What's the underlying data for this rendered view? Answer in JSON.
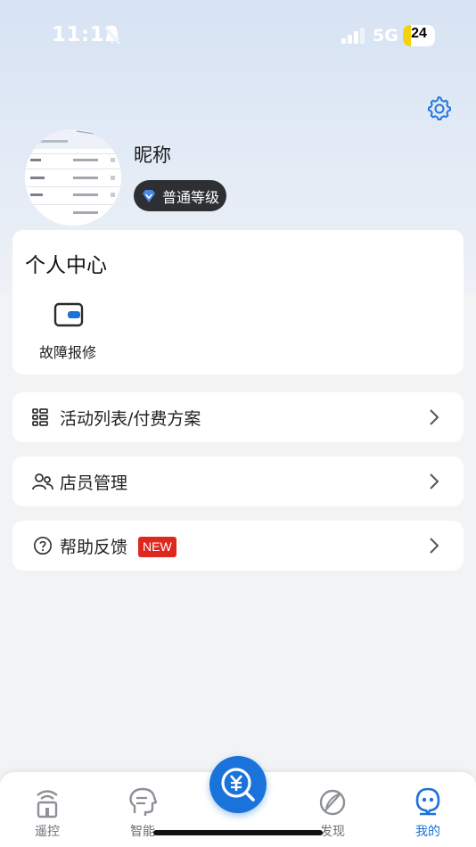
{
  "status_bar": {
    "time": "11:12",
    "network": "5G",
    "battery": "24",
    "battery_level": 0.24
  },
  "profile": {
    "nickname": "昵称",
    "level": "普通等级"
  },
  "personal_center": {
    "title": "个人中心",
    "items": [
      {
        "label": "故障报修",
        "icon": "wallet-icon"
      }
    ]
  },
  "menu": [
    {
      "label": "活动列表/付费方案",
      "icon": "list-icon"
    },
    {
      "label": "店员管理",
      "icon": "staff-icon"
    },
    {
      "label": "帮助反馈",
      "icon": "help-icon",
      "badge": "NEW"
    }
  ],
  "bottom_nav": {
    "items": [
      {
        "label": "遥控",
        "icon": "remote-icon"
      },
      {
        "label": "智能",
        "icon": "smart-icon"
      },
      {
        "label": "发现",
        "icon": "discover-icon"
      },
      {
        "label": "我的",
        "icon": "profile-icon",
        "active": true
      }
    ],
    "center": {
      "icon": "yuan-search-icon"
    }
  },
  "colors": {
    "accent": "#1d72d8",
    "badge_red": "#e0271d",
    "level_badge_bg": "#2d2f33",
    "battery": "#f5d20f"
  }
}
